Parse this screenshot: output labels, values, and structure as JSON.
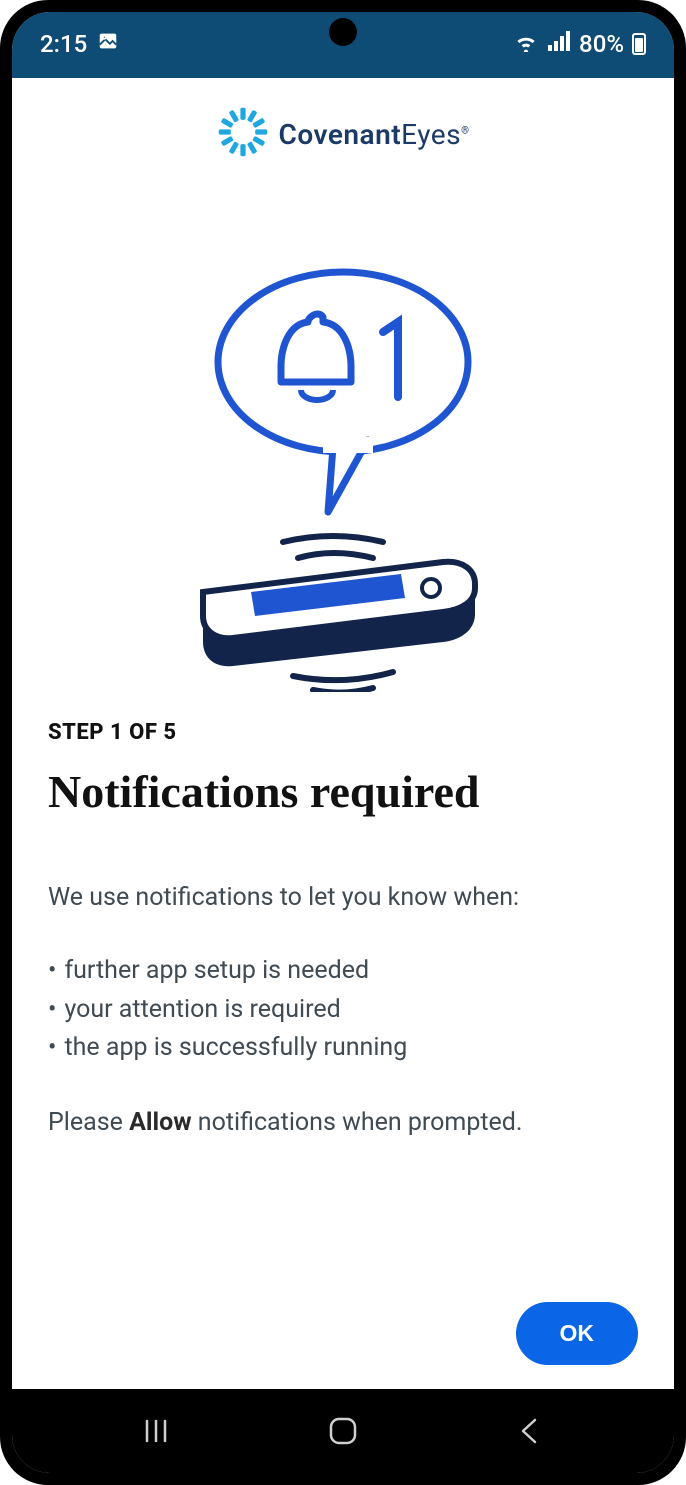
{
  "status": {
    "time": "2:15",
    "battery_pct": "80%"
  },
  "logo": {
    "word1": "Covenant",
    "word2": "Eyes"
  },
  "step": "STEP 1 OF 5",
  "title": "Notifications required",
  "lead": "We use notifications to let you know when:",
  "bullets": [
    "further app setup is needed",
    "your attention is required",
    "the app is successfully running"
  ],
  "closing_pre": "Please ",
  "closing_strong": "Allow",
  "closing_post": " notifications when prompted.",
  "ok_label": "OK"
}
